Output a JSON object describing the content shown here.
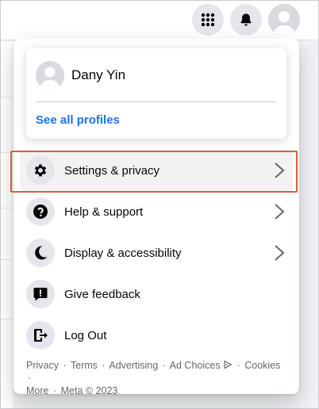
{
  "topbar": {
    "menu_icon": "grid-menu-icon",
    "notification_icon": "bell-icon",
    "avatar_icon": "avatar"
  },
  "profile": {
    "name": "Dany Yin",
    "see_all": "See all profiles"
  },
  "menu": {
    "items": [
      {
        "label": "Settings & privacy",
        "icon": "gear-icon",
        "has_chevron": true
      },
      {
        "label": "Help & support",
        "icon": "help-icon",
        "has_chevron": true
      },
      {
        "label": "Display & accessibility",
        "icon": "moon-icon",
        "has_chevron": true
      },
      {
        "label": "Give feedback",
        "icon": "feedback-icon",
        "has_chevron": false
      },
      {
        "label": "Log Out",
        "icon": "logout-icon",
        "has_chevron": false
      }
    ]
  },
  "footer": {
    "privacy": "Privacy",
    "terms": "Terms",
    "advertising": "Advertising",
    "ad_choices": "Ad Choices",
    "cookies": "Cookies",
    "more": "More",
    "meta": "Meta © 2023",
    "separator": "·"
  },
  "colors": {
    "accent": "#1b74e4",
    "highlight_border": "#d2613c"
  }
}
